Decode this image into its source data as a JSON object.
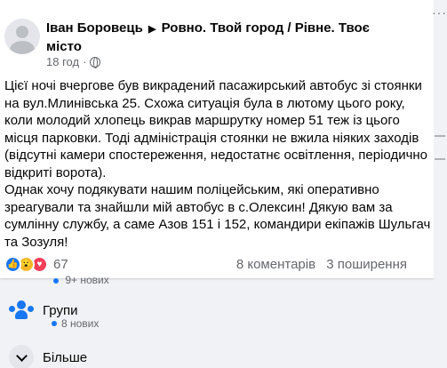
{
  "post": {
    "author": "Іван Боровець",
    "group": "Ровно. Твой город / Рівне. Твоє місто",
    "time": "18 год",
    "text": "Цієї ночі вчергове був викрадений пасажирський автобус зі стоянки на вул.Млинівська 25. Схожа ситуація була в лютому цього року, коли молодий хлопець викрав  маршрутку номер 51 теж із цього місця парковки. Тоді адміністрація стоянки не вжила ніяких заходів (відсутні камери спостереження, недостатнє освітлення, періодично відкриті ворота).\nОднак хочу подякувати нашим поліцейським, які оперативно зреагували та знайшли мій автобус в с.Олексин! Дякую вам за сумлінну службу, а саме Азов 151 і 152, командири екіпажів Шульгач та Зозуля!",
    "reactions": {
      "icons": [
        "like-icon",
        "wow-icon",
        "love-icon"
      ],
      "count": "67"
    },
    "comments": "8 коментарів",
    "shares": "3 поширення"
  },
  "sidebar": {
    "top_sub": "9+ нових",
    "groups_label": "Групи",
    "groups_sub": "8 нових",
    "more_label": "Більше"
  },
  "colors": {
    "accent": "#1877f2",
    "text": "#050505",
    "secondary": "#65676b"
  }
}
